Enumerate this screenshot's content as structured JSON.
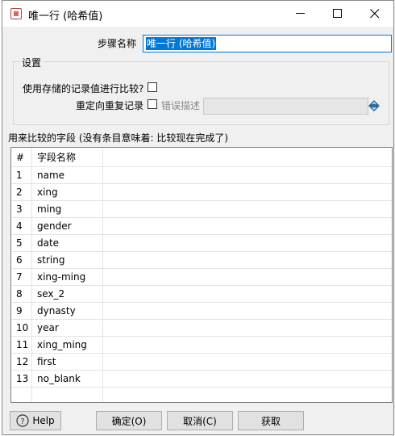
{
  "window": {
    "title": "唯一行 (哈希值)"
  },
  "form": {
    "step_name_label": "步骤名称",
    "step_name_value": "唯一行 (哈希值)",
    "settings_group": "设置",
    "use_stored_label": "使用存储的记录值进行比较?",
    "redirect_label": "重定向重复记录",
    "error_desc_label": "错误描述",
    "error_desc_value": ""
  },
  "fields_caption": "用来比较的字段 (没有条目意味着: 比较现在完成了)",
  "table": {
    "headers": [
      "#",
      "字段名称"
    ],
    "rows": [
      {
        "num": "1",
        "name": "name"
      },
      {
        "num": "2",
        "name": "xing"
      },
      {
        "num": "3",
        "name": "ming"
      },
      {
        "num": "4",
        "name": "gender"
      },
      {
        "num": "5",
        "name": "date"
      },
      {
        "num": "6",
        "name": "string"
      },
      {
        "num": "7",
        "name": "xing-ming"
      },
      {
        "num": "8",
        "name": "sex_2"
      },
      {
        "num": "9",
        "name": "dynasty"
      },
      {
        "num": "10",
        "name": "year"
      },
      {
        "num": "11",
        "name": "xing_ming"
      },
      {
        "num": "12",
        "name": "first"
      },
      {
        "num": "13",
        "name": "no_blank"
      }
    ]
  },
  "buttons": {
    "help": "Help",
    "ok": "确定(O)",
    "cancel": "取消(C)",
    "get": "获取"
  },
  "icons": {
    "title_icon": "spoon-step-icon",
    "help_icon": "help-circle-icon",
    "variable_icon": "variable-diamond-icon"
  },
  "colors": {
    "selection": "#0078d7",
    "window_bg": "#f0f0f0",
    "variable_icon": "#2b6aa3"
  }
}
